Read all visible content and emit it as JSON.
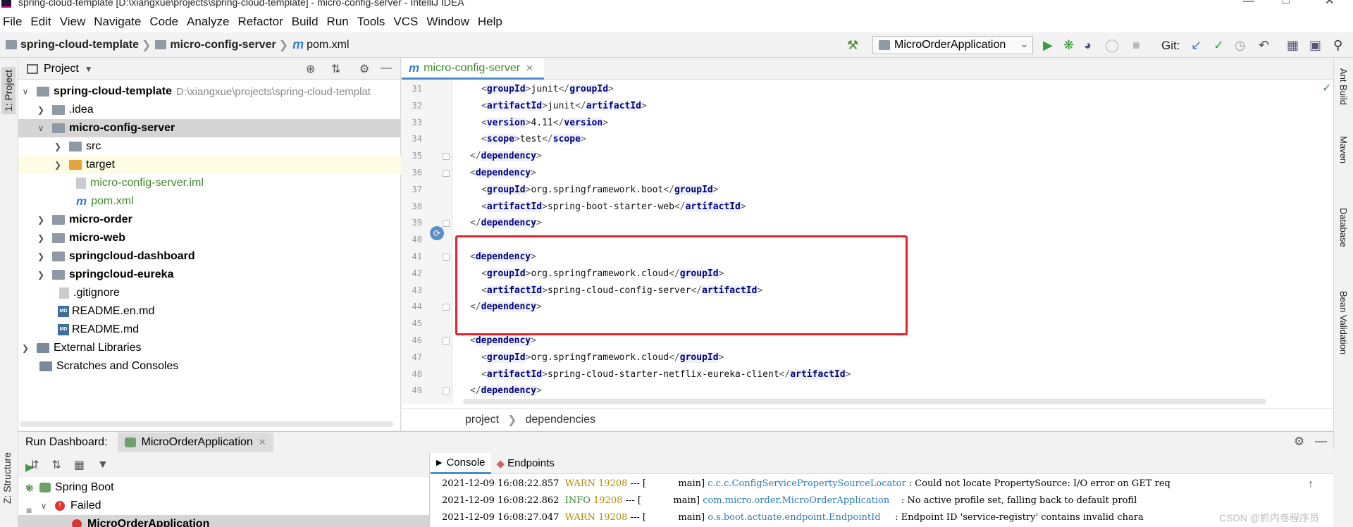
{
  "window": {
    "title": "spring-cloud-template [D:\\xiangxue\\projects\\spring-cloud-template] - micro-config-server - IntelliJ IDEA"
  },
  "menu": [
    "File",
    "Edit",
    "View",
    "Navigate",
    "Code",
    "Analyze",
    "Refactor",
    "Build",
    "Run",
    "Tools",
    "VCS",
    "Window",
    "Help"
  ],
  "breadcrumb": {
    "root": "spring-cloud-template",
    "module": "micro-config-server",
    "file": "pom.xml"
  },
  "toolbar": {
    "run_config": "MicroOrderApplication",
    "git_label": "Git:"
  },
  "left_tabs": {
    "project": "1: Project",
    "structure": "Z: Structure"
  },
  "right_tabs": [
    "Ant Build",
    "Maven",
    "Database",
    "Bean Validation"
  ],
  "project_panel": {
    "title": "Project",
    "tree": [
      {
        "label": "spring-cloud-template",
        "extra": "D:\\xiangxue\\projects\\spring-cloud-templat"
      },
      {
        "label": ".idea"
      },
      {
        "label": "micro-config-server"
      },
      {
        "label": "src"
      },
      {
        "label": "target"
      },
      {
        "label": "micro-config-server.iml"
      },
      {
        "label": "pom.xml"
      },
      {
        "label": "micro-order"
      },
      {
        "label": "micro-web"
      },
      {
        "label": "springcloud-dashboard"
      },
      {
        "label": "springcloud-eureka"
      },
      {
        "label": ".gitignore"
      },
      {
        "label": "README.en.md"
      },
      {
        "label": "README.md"
      },
      {
        "label": "External Libraries"
      },
      {
        "label": "Scratches and Consoles"
      }
    ]
  },
  "editor": {
    "tab": "micro-config-server",
    "lines": [
      {
        "n": "31",
        "i": 1,
        "tag": "groupId",
        "val": "junit"
      },
      {
        "n": "32",
        "i": 1,
        "tag": "artifactId",
        "val": "junit"
      },
      {
        "n": "33",
        "i": 1,
        "tag": "version",
        "val": "4.11"
      },
      {
        "n": "34",
        "i": 1,
        "tag": "scope",
        "val": "test"
      },
      {
        "n": "35",
        "i": 0,
        "close": "dependency"
      },
      {
        "n": "36",
        "i": 0,
        "open": "dependency"
      },
      {
        "n": "37",
        "i": 1,
        "tag": "groupId",
        "val": "org.springframework.boot"
      },
      {
        "n": "38",
        "i": 1,
        "tag": "artifactId",
        "val": "spring-boot-starter-web"
      },
      {
        "n": "39",
        "i": 0,
        "close": "dependency"
      },
      {
        "n": "40",
        "i": 0
      },
      {
        "n": "41",
        "i": 0,
        "open": "dependency"
      },
      {
        "n": "42",
        "i": 1,
        "tag": "groupId",
        "val": "org.springframework.cloud"
      },
      {
        "n": "43",
        "i": 1,
        "tag": "artifactId",
        "val": "spring-cloud-config-server"
      },
      {
        "n": "44",
        "i": 0,
        "close": "dependency"
      },
      {
        "n": "45",
        "i": 0
      },
      {
        "n": "46",
        "i": 0,
        "open": "dependency"
      },
      {
        "n": "47",
        "i": 1,
        "tag": "groupId",
        "val": "org.springframework.cloud"
      },
      {
        "n": "48",
        "i": 1,
        "tag": "artifactId",
        "val": "spring-cloud-starter-netflix-eureka-client"
      },
      {
        "n": "49",
        "i": 0,
        "close": "dependency"
      }
    ],
    "breadcrumb": [
      "project",
      "dependencies"
    ]
  },
  "run_dashboard": {
    "label": "Run Dashboard:",
    "tab": "MicroOrderApplication",
    "tree": [
      "Spring Boot",
      "Failed",
      "MicroOrderApplication"
    ],
    "console_tabs": [
      "Console",
      "Endpoints"
    ],
    "logs": [
      {
        "ts": "2021-12-09 16:08:22.857",
        "level": "WARN",
        "pid": "19208",
        "mid": "--- [           main]",
        "logger": "c.c.c.ConfigServicePropertySourceLocator",
        "msg": ": Could not locate PropertySource: I/O error on GET req"
      },
      {
        "ts": "2021-12-09 16:08:22.862",
        "level": "INFO",
        "pid": "19208",
        "mid": "--- [           main]",
        "logger": "com.micro.order.MicroOrderApplication   ",
        "msg": ": No active profile set, falling back to default profil"
      },
      {
        "ts": "2021-12-09 16:08:27.047",
        "level": "WARN",
        "pid": "19208",
        "mid": "--- [           main]",
        "logger": "o.s.boot.actuate.endpoint.EndpointId    ",
        "msg": ": Endpoint ID 'service-registry' contains invalid chara"
      }
    ]
  },
  "watermark": "CSDN @抓内卷程序员"
}
